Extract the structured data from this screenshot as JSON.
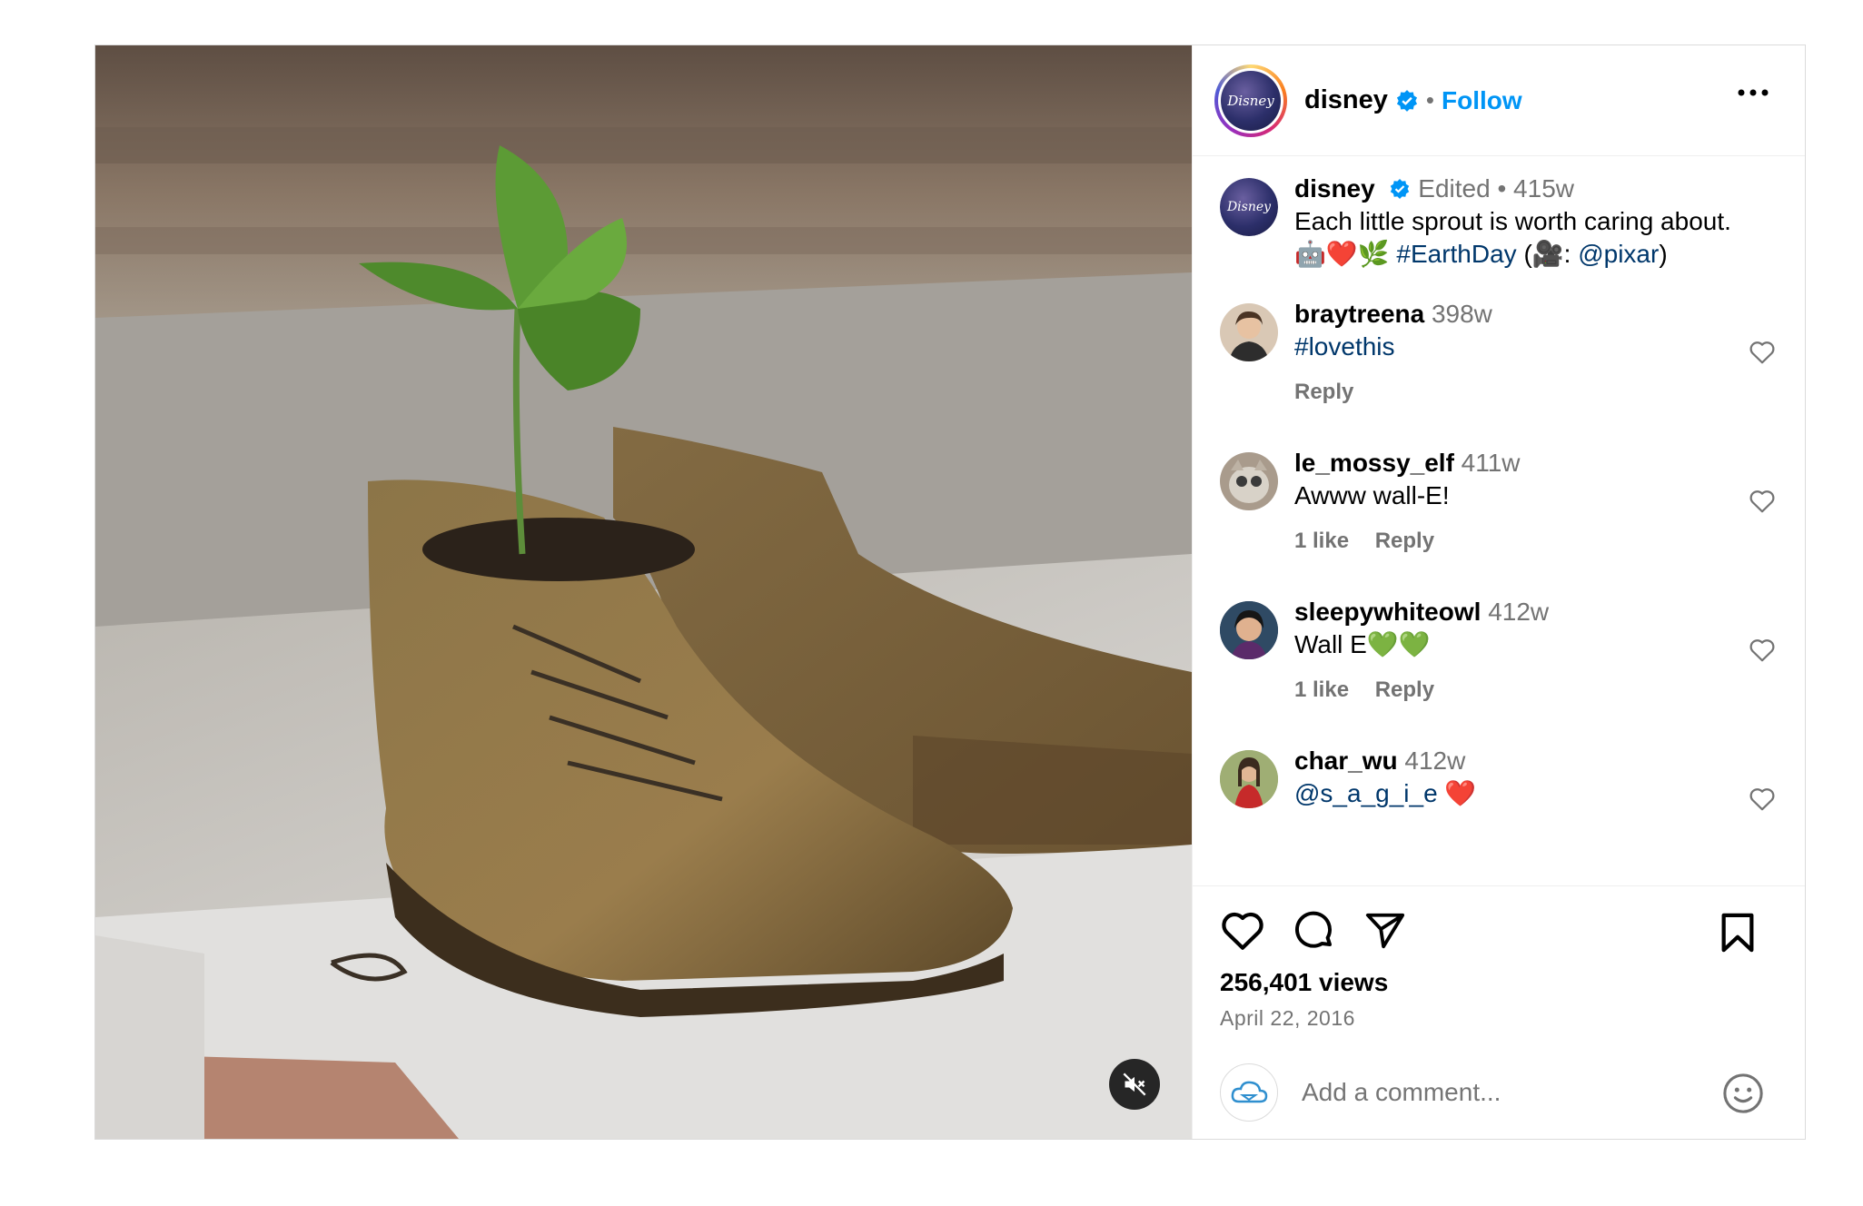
{
  "post": {
    "account": {
      "username": "disney",
      "follow_label": "Follow",
      "dot": "•"
    },
    "caption": {
      "username": "disney",
      "edited": "Edited",
      "dot": "•",
      "time": "415w",
      "text_line1": "Each little sprout is worth caring about.",
      "emojis": "🤖❤️🌿",
      "hashtag": "#EarthDay",
      "credit_open": "(🎥:",
      "mention": "@pixar",
      "credit_close": ")"
    },
    "comments": [
      {
        "username": "braytreena",
        "time": "398w",
        "text": "#lovethis",
        "likes": "",
        "reply": "Reply"
      },
      {
        "username": "le_mossy_elf",
        "time": "411w",
        "text": "Awww wall-E!",
        "likes": "1 like",
        "reply": "Reply"
      },
      {
        "username": "sleepywhiteowl",
        "time": "412w",
        "text": "Wall E💚💚",
        "likes": "1 like",
        "reply": "Reply"
      },
      {
        "username": "char_wu",
        "time": "412w",
        "mention": "@s_a_g_i_e",
        "text": " ❤️",
        "likes": "",
        "reply": ""
      }
    ],
    "views": "256,401 views",
    "date": "April 22, 2016",
    "add_comment_placeholder": "Add a comment...",
    "icons": {
      "like": "heart-icon",
      "comment": "comment-bubble-icon",
      "share": "paper-plane-icon",
      "save": "bookmark-icon",
      "more": "more-options-icon",
      "mute": "speaker-muted-icon",
      "emoji": "smiley-icon"
    },
    "colors": {
      "follow": "#0095f6",
      "link": "#00376b",
      "muted_text": "#737373",
      "verified": "#0095f6"
    }
  }
}
